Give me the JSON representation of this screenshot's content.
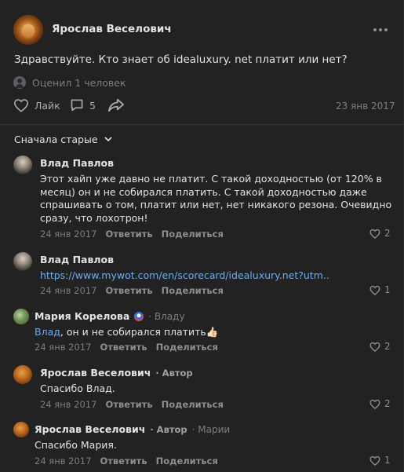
{
  "post": {
    "author": "Ярослав Веселович",
    "text": "Здравствуйте. Кто знает об idealuxury. net платит или нет?",
    "rated": "Оценил 1 человек",
    "like_label": "Лайк",
    "comments_count": "5",
    "date": "23 янв 2017"
  },
  "sort_label": "Сначала старые",
  "comments": [
    {
      "author": "Влад Павлов",
      "text": "Этот хайп уже давно не платит. С такой доходностью (от 120% в месяц) он и не собирался платить. С такой доходностью даже спрашивать о том, платит или нет, нет никакого резона. Очевидно сразу, что лохотрон!",
      "date": "24 янв 2017",
      "reply": "Ответить",
      "share": "Поделиться",
      "likes": "2"
    },
    {
      "author": "Влад Павлов",
      "link": "https://www.mywot.com/en/scorecard/idealuxury.net?utm..",
      "date": "24 янв 2017",
      "reply": "Ответить",
      "share": "Поделиться",
      "likes": "1"
    },
    {
      "author": "Мария Корелова",
      "reply_to": "· Владу",
      "mention": "Влад",
      "text": ", он и не собирался платить👍🏻",
      "date": "24 янв 2017",
      "reply": "Ответить",
      "share": "Поделиться",
      "likes": "2"
    },
    {
      "author": "Ярослав Веселович",
      "badge": "· Автор",
      "text": "Спасибо Влад.",
      "date": "24 янв 2017",
      "reply": "Ответить",
      "share": "Поделиться",
      "likes": "2"
    },
    {
      "author": "Ярослав Веселович",
      "badge": "· Автор",
      "reply_to": "· Марии",
      "text": "Спасибо Мария.",
      "date": "24 янв 2017",
      "reply": "Ответить",
      "share": "Поделиться",
      "likes": "1"
    }
  ],
  "colors": {
    "background": "#222222",
    "link": "#71aaeb",
    "muted": "#7a7d82"
  }
}
